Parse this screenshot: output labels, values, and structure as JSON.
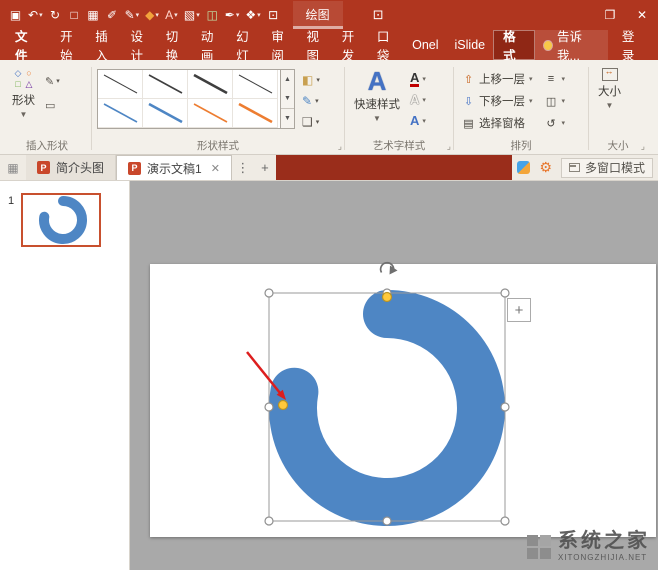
{
  "titlebar": {
    "qat": [
      {
        "name": "save-icon",
        "glyph": "▣"
      },
      {
        "name": "undo-icon",
        "glyph": "↶",
        "dropdown": true
      },
      {
        "name": "redo-icon",
        "glyph": "↻"
      },
      {
        "name": "new-file-icon",
        "glyph": "□"
      },
      {
        "name": "table-icon",
        "glyph": "▦"
      },
      {
        "name": "format-painter-icon",
        "glyph": "✐"
      },
      {
        "name": "pen-icon",
        "glyph": "✎",
        "dropdown": true
      },
      {
        "name": "fill-color-icon",
        "glyph": "◆",
        "color": "#F2A33C",
        "dropdown": true
      },
      {
        "name": "font-color-icon",
        "glyph": "A",
        "color": "#FFD2C8",
        "dropdown": true
      },
      {
        "name": "picture-icon",
        "glyph": "▧",
        "dropdown": true
      },
      {
        "name": "textbox-icon",
        "glyph": "◫",
        "color": "#BFE3A8"
      },
      {
        "name": "brush-icon",
        "glyph": "✒",
        "dropdown": true
      },
      {
        "name": "shapes-icon",
        "glyph": "❖",
        "dropdown": true
      },
      {
        "name": "slideshow-icon",
        "glyph": "⊡"
      }
    ],
    "contextual_label": "绘图",
    "display_icon_glyph": "⊡",
    "restore_glyph": "❐",
    "close_glyph": "✕"
  },
  "menu": {
    "file": "文件",
    "tabs": [
      "开始",
      "插入",
      "设计",
      "切换",
      "动画",
      "幻灯",
      "审阅",
      "视图",
      "开发",
      "口袋",
      "Onel",
      "iSlide"
    ],
    "format_tab": "格式",
    "tell_me": "告诉我...",
    "sign_in": "登录"
  },
  "ribbon": {
    "insert_shapes": {
      "label": "插入形状",
      "shapes_button": "形状"
    },
    "shape_styles": {
      "label": "形状样式",
      "samples": [
        {
          "color": "#3f3f3f",
          "width": 1
        },
        {
          "color": "#3f3f3f",
          "width": 1.6
        },
        {
          "color": "#3f3f3f",
          "width": 2.6
        },
        {
          "color": "#3f3f3f",
          "width": 1
        },
        {
          "color": "#4e86c4",
          "width": 1.6
        },
        {
          "color": "#4e86c4",
          "width": 2.6
        },
        {
          "color": "#ed7d31",
          "width": 1.6
        },
        {
          "color": "#ed7d31",
          "width": 2.6
        }
      ]
    },
    "wordart": {
      "label": "艺术字样式",
      "quick_styles": "快速样式"
    },
    "arrange": {
      "label": "排列",
      "bring_forward": "上移一层",
      "send_backward": "下移一层",
      "selection_pane": "选择窗格"
    },
    "size": {
      "label": "大小",
      "button": "大小"
    }
  },
  "doc_tabs": {
    "tab1": "简介头图",
    "tab2": "演示文稿1",
    "multi_window": "多窗口模式"
  },
  "slide_panel": {
    "number": "1"
  },
  "canvas": {
    "shape_fill": "#4E86C4"
  },
  "watermark": {
    "title": "系统之家",
    "url": "XITONGZHIJIA.NET"
  }
}
